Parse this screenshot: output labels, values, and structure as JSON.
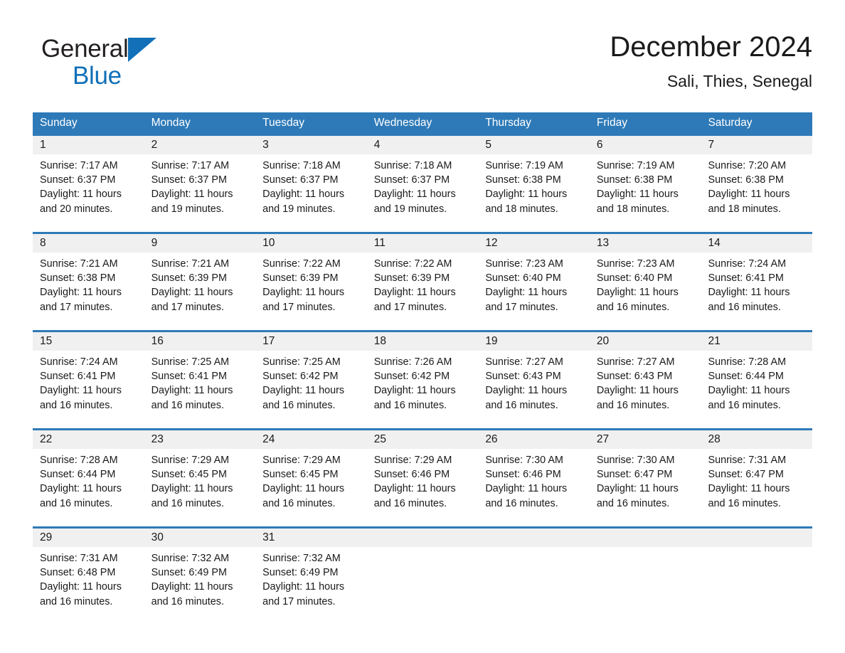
{
  "brand": {
    "name_part1": "General",
    "name_part2": "Blue",
    "triangle_color": "#1170b8",
    "text_color": "#231f20"
  },
  "header": {
    "title": "December 2024",
    "subtitle": "Sali, Thies, Senegal"
  },
  "theme": {
    "header_bar": "#2e7ab8",
    "row_divider": "#2e7ab8",
    "daynum_band": "#f0f0f0",
    "text": "#1a1a1a"
  },
  "weekdays": [
    "Sunday",
    "Monday",
    "Tuesday",
    "Wednesday",
    "Thursday",
    "Friday",
    "Saturday"
  ],
  "weeks": [
    {
      "days": [
        {
          "num": "1",
          "sunrise": "Sunrise: 7:17 AM",
          "sunset": "Sunset: 6:37 PM",
          "daylight1": "Daylight: 11 hours",
          "daylight2": "and 20 minutes."
        },
        {
          "num": "2",
          "sunrise": "Sunrise: 7:17 AM",
          "sunset": "Sunset: 6:37 PM",
          "daylight1": "Daylight: 11 hours",
          "daylight2": "and 19 minutes."
        },
        {
          "num": "3",
          "sunrise": "Sunrise: 7:18 AM",
          "sunset": "Sunset: 6:37 PM",
          "daylight1": "Daylight: 11 hours",
          "daylight2": "and 19 minutes."
        },
        {
          "num": "4",
          "sunrise": "Sunrise: 7:18 AM",
          "sunset": "Sunset: 6:37 PM",
          "daylight1": "Daylight: 11 hours",
          "daylight2": "and 19 minutes."
        },
        {
          "num": "5",
          "sunrise": "Sunrise: 7:19 AM",
          "sunset": "Sunset: 6:38 PM",
          "daylight1": "Daylight: 11 hours",
          "daylight2": "and 18 minutes."
        },
        {
          "num": "6",
          "sunrise": "Sunrise: 7:19 AM",
          "sunset": "Sunset: 6:38 PM",
          "daylight1": "Daylight: 11 hours",
          "daylight2": "and 18 minutes."
        },
        {
          "num": "7",
          "sunrise": "Sunrise: 7:20 AM",
          "sunset": "Sunset: 6:38 PM",
          "daylight1": "Daylight: 11 hours",
          "daylight2": "and 18 minutes."
        }
      ]
    },
    {
      "days": [
        {
          "num": "8",
          "sunrise": "Sunrise: 7:21 AM",
          "sunset": "Sunset: 6:38 PM",
          "daylight1": "Daylight: 11 hours",
          "daylight2": "and 17 minutes."
        },
        {
          "num": "9",
          "sunrise": "Sunrise: 7:21 AM",
          "sunset": "Sunset: 6:39 PM",
          "daylight1": "Daylight: 11 hours",
          "daylight2": "and 17 minutes."
        },
        {
          "num": "10",
          "sunrise": "Sunrise: 7:22 AM",
          "sunset": "Sunset: 6:39 PM",
          "daylight1": "Daylight: 11 hours",
          "daylight2": "and 17 minutes."
        },
        {
          "num": "11",
          "sunrise": "Sunrise: 7:22 AM",
          "sunset": "Sunset: 6:39 PM",
          "daylight1": "Daylight: 11 hours",
          "daylight2": "and 17 minutes."
        },
        {
          "num": "12",
          "sunrise": "Sunrise: 7:23 AM",
          "sunset": "Sunset: 6:40 PM",
          "daylight1": "Daylight: 11 hours",
          "daylight2": "and 17 minutes."
        },
        {
          "num": "13",
          "sunrise": "Sunrise: 7:23 AM",
          "sunset": "Sunset: 6:40 PM",
          "daylight1": "Daylight: 11 hours",
          "daylight2": "and 16 minutes."
        },
        {
          "num": "14",
          "sunrise": "Sunrise: 7:24 AM",
          "sunset": "Sunset: 6:41 PM",
          "daylight1": "Daylight: 11 hours",
          "daylight2": "and 16 minutes."
        }
      ]
    },
    {
      "days": [
        {
          "num": "15",
          "sunrise": "Sunrise: 7:24 AM",
          "sunset": "Sunset: 6:41 PM",
          "daylight1": "Daylight: 11 hours",
          "daylight2": "and 16 minutes."
        },
        {
          "num": "16",
          "sunrise": "Sunrise: 7:25 AM",
          "sunset": "Sunset: 6:41 PM",
          "daylight1": "Daylight: 11 hours",
          "daylight2": "and 16 minutes."
        },
        {
          "num": "17",
          "sunrise": "Sunrise: 7:25 AM",
          "sunset": "Sunset: 6:42 PM",
          "daylight1": "Daylight: 11 hours",
          "daylight2": "and 16 minutes."
        },
        {
          "num": "18",
          "sunrise": "Sunrise: 7:26 AM",
          "sunset": "Sunset: 6:42 PM",
          "daylight1": "Daylight: 11 hours",
          "daylight2": "and 16 minutes."
        },
        {
          "num": "19",
          "sunrise": "Sunrise: 7:27 AM",
          "sunset": "Sunset: 6:43 PM",
          "daylight1": "Daylight: 11 hours",
          "daylight2": "and 16 minutes."
        },
        {
          "num": "20",
          "sunrise": "Sunrise: 7:27 AM",
          "sunset": "Sunset: 6:43 PM",
          "daylight1": "Daylight: 11 hours",
          "daylight2": "and 16 minutes."
        },
        {
          "num": "21",
          "sunrise": "Sunrise: 7:28 AM",
          "sunset": "Sunset: 6:44 PM",
          "daylight1": "Daylight: 11 hours",
          "daylight2": "and 16 minutes."
        }
      ]
    },
    {
      "days": [
        {
          "num": "22",
          "sunrise": "Sunrise: 7:28 AM",
          "sunset": "Sunset: 6:44 PM",
          "daylight1": "Daylight: 11 hours",
          "daylight2": "and 16 minutes."
        },
        {
          "num": "23",
          "sunrise": "Sunrise: 7:29 AM",
          "sunset": "Sunset: 6:45 PM",
          "daylight1": "Daylight: 11 hours",
          "daylight2": "and 16 minutes."
        },
        {
          "num": "24",
          "sunrise": "Sunrise: 7:29 AM",
          "sunset": "Sunset: 6:45 PM",
          "daylight1": "Daylight: 11 hours",
          "daylight2": "and 16 minutes."
        },
        {
          "num": "25",
          "sunrise": "Sunrise: 7:29 AM",
          "sunset": "Sunset: 6:46 PM",
          "daylight1": "Daylight: 11 hours",
          "daylight2": "and 16 minutes."
        },
        {
          "num": "26",
          "sunrise": "Sunrise: 7:30 AM",
          "sunset": "Sunset: 6:46 PM",
          "daylight1": "Daylight: 11 hours",
          "daylight2": "and 16 minutes."
        },
        {
          "num": "27",
          "sunrise": "Sunrise: 7:30 AM",
          "sunset": "Sunset: 6:47 PM",
          "daylight1": "Daylight: 11 hours",
          "daylight2": "and 16 minutes."
        },
        {
          "num": "28",
          "sunrise": "Sunrise: 7:31 AM",
          "sunset": "Sunset: 6:47 PM",
          "daylight1": "Daylight: 11 hours",
          "daylight2": "and 16 minutes."
        }
      ]
    },
    {
      "days": [
        {
          "num": "29",
          "sunrise": "Sunrise: 7:31 AM",
          "sunset": "Sunset: 6:48 PM",
          "daylight1": "Daylight: 11 hours",
          "daylight2": "and 16 minutes."
        },
        {
          "num": "30",
          "sunrise": "Sunrise: 7:32 AM",
          "sunset": "Sunset: 6:49 PM",
          "daylight1": "Daylight: 11 hours",
          "daylight2": "and 16 minutes."
        },
        {
          "num": "31",
          "sunrise": "Sunrise: 7:32 AM",
          "sunset": "Sunset: 6:49 PM",
          "daylight1": "Daylight: 11 hours",
          "daylight2": "and 17 minutes."
        },
        {
          "num": "",
          "sunrise": "",
          "sunset": "",
          "daylight1": "",
          "daylight2": ""
        },
        {
          "num": "",
          "sunrise": "",
          "sunset": "",
          "daylight1": "",
          "daylight2": ""
        },
        {
          "num": "",
          "sunrise": "",
          "sunset": "",
          "daylight1": "",
          "daylight2": ""
        },
        {
          "num": "",
          "sunrise": "",
          "sunset": "",
          "daylight1": "",
          "daylight2": ""
        }
      ]
    }
  ]
}
